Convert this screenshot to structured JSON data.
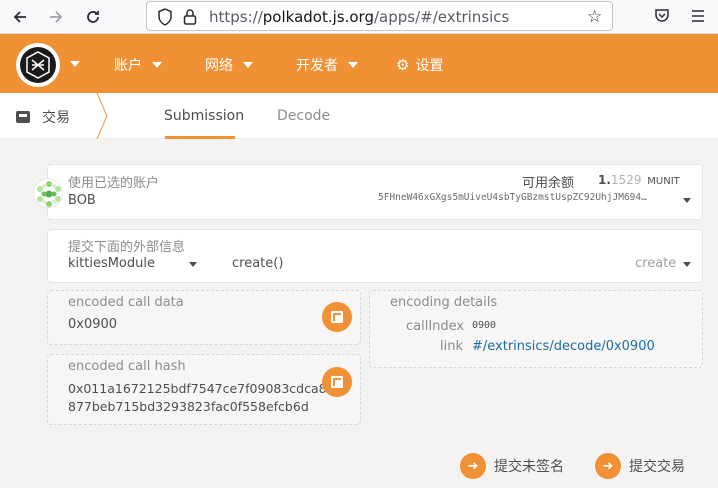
{
  "browser": {
    "url_prefix": "https://",
    "url_host": "polkadot.js.org",
    "url_path": "/apps/#/extrinsics"
  },
  "header": {
    "menu": [
      {
        "label": "账户"
      },
      {
        "label": "网络"
      },
      {
        "label": "开发者"
      },
      {
        "label": "设置"
      }
    ]
  },
  "subnav": {
    "section": "交易",
    "tabs": [
      {
        "label": "Submission"
      },
      {
        "label": "Decode"
      }
    ]
  },
  "account": {
    "label": "使用已选的账户",
    "name": "BOB",
    "balance_label": "可用余额",
    "balance_int": "1.",
    "balance_frac": "1529",
    "balance_unit": "MUNIT",
    "address": "5FHneW46xGXgs5mUiveU4sbTyGBzmstUspZC92UhjJM694…"
  },
  "extrinsic": {
    "label": "提交下面的外部信息",
    "module": "kittiesModule",
    "method": "create()",
    "method_select": "create"
  },
  "call_data": {
    "label": "encoded call data",
    "value": "0x0900"
  },
  "call_hash": {
    "label": "encoded call hash",
    "line1": "0x011a1672125bdf7547ce7f09083cdca8",
    "line2": "877beb715bd3293823fac0f558efcb6d"
  },
  "details": {
    "label": "encoding details",
    "call_index_label": "callIndex",
    "call_index_value": "0900",
    "link_label": "link",
    "link_value": "#/extrinsics/decode/0x0900"
  },
  "actions": {
    "unsigned": "提交未签名",
    "submit": "提交交易"
  },
  "colors": {
    "accent": "#f19135",
    "link": "#1b6ca8"
  }
}
